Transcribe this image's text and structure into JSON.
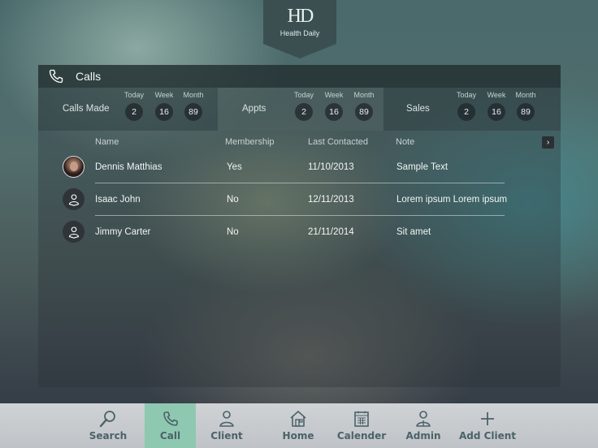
{
  "logo": {
    "mark": "HD",
    "brand": "Health Daily"
  },
  "header": {
    "title": "Calls"
  },
  "stats": [
    {
      "label": "Calls Made",
      "today_label": "Today",
      "week_label": "Week",
      "month_label": "Month",
      "today": "2",
      "week": "16",
      "month": "89"
    },
    {
      "label": "Appts",
      "today_label": "Today",
      "week_label": "Week",
      "month_label": "Month",
      "today": "2",
      "week": "16",
      "month": "89"
    },
    {
      "label": "Sales",
      "today_label": "Today",
      "week_label": "Week",
      "month_label": "Month",
      "today": "2",
      "week": "16",
      "month": "89"
    }
  ],
  "table": {
    "columns": [
      "Name",
      "Membership",
      "Last Contacted",
      "Note"
    ],
    "more_icon": "chevron-right-icon",
    "rows": [
      {
        "name": "Dennis Matthias",
        "membership": "Yes",
        "last_contacted": "11/10/2013",
        "note": "Sample Text",
        "avatar": "photo"
      },
      {
        "name": "Isaac John",
        "membership": "No",
        "last_contacted": "12/11/2013",
        "note": "Lorem ipsum Lorem ipsum",
        "avatar": "user-icon"
      },
      {
        "name": "Jimmy Carter",
        "membership": "No",
        "last_contacted": "21/11/2014",
        "note": "Sit amet",
        "avatar": "user-icon"
      }
    ]
  },
  "nav": [
    {
      "label": "Search",
      "icon": "search-icon"
    },
    {
      "label": "Call",
      "icon": "phone-icon",
      "active": true
    },
    {
      "label": "Client",
      "icon": "user-icon"
    },
    {
      "label": "Home",
      "icon": "home-icon"
    },
    {
      "label": "Calender",
      "icon": "calendar-icon"
    },
    {
      "label": "Admin",
      "icon": "admin-icon"
    },
    {
      "label": "Add Client",
      "icon": "plus-icon"
    }
  ],
  "colors": {
    "active_tab": "#8fc8b0",
    "nav_bg": "#c8ccd0",
    "header_bg": "#233032"
  }
}
